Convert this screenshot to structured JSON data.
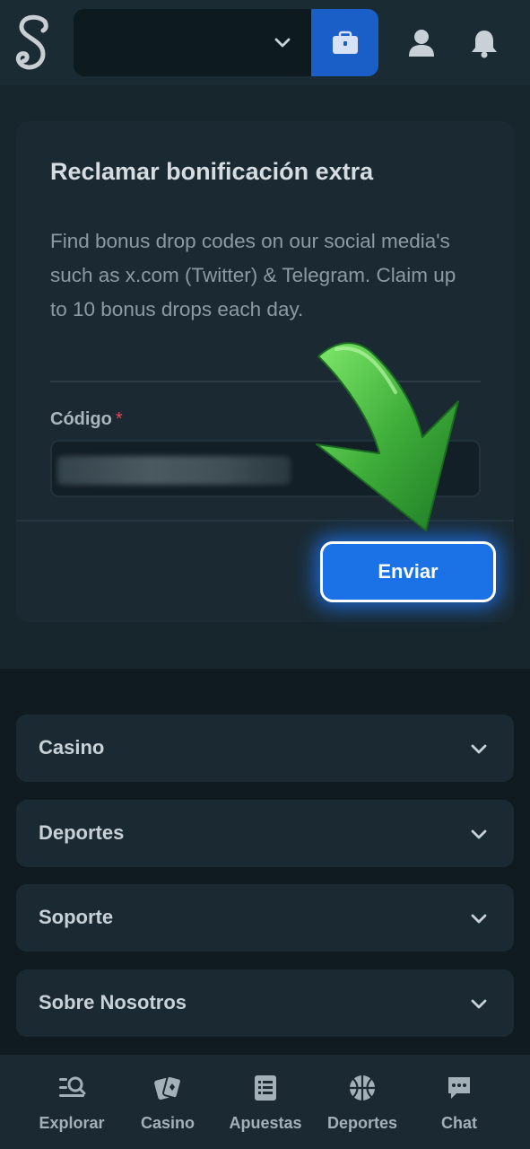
{
  "header": {
    "logo_letter": "S",
    "balance_value": "",
    "icons": [
      "chevron-down-icon",
      "wallet-icon",
      "user-icon",
      "bell-icon"
    ]
  },
  "bonus_card": {
    "title": "Reclamar bonificación extra",
    "description": "Find bonus drop codes on our social media's such as x.com (Twitter) & Telegram. Claim up to 10 bonus drops each day.",
    "code_label": "Código",
    "required_mark": "*",
    "code_value": "",
    "submit_label": "Enviar"
  },
  "accordion": [
    {
      "label": "Casino"
    },
    {
      "label": "Deportes"
    },
    {
      "label": "Soporte"
    },
    {
      "label": "Sobre Nosotros"
    }
  ],
  "bottom_nav": [
    {
      "label": "Explorar",
      "icon": "explore-icon"
    },
    {
      "label": "Casino",
      "icon": "cards-icon"
    },
    {
      "label": "Apuestas",
      "icon": "betslip-icon"
    },
    {
      "label": "Deportes",
      "icon": "basketball-icon"
    },
    {
      "label": "Chat",
      "icon": "chat-icon"
    }
  ],
  "colors": {
    "accent": "#1a72e6",
    "arrow": "#3fae3a",
    "background": "#0f1c22"
  }
}
